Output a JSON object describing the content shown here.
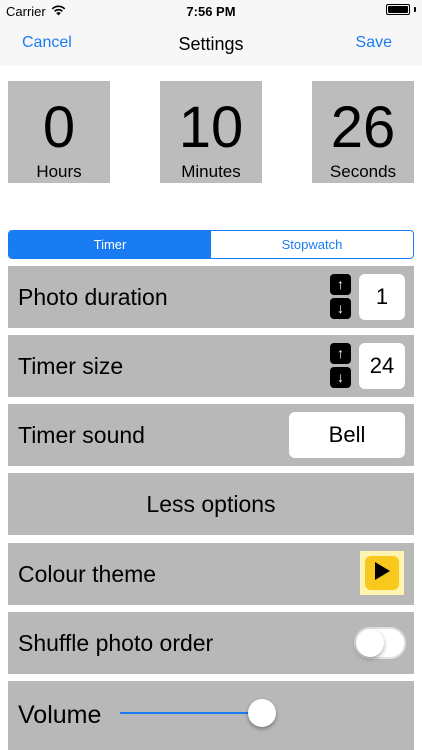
{
  "status_bar": {
    "carrier": "Carrier",
    "time": "7:56 PM"
  },
  "nav": {
    "cancel": "Cancel",
    "title": "Settings",
    "save": "Save"
  },
  "timer": {
    "hours": {
      "value": "0",
      "label": "Hours"
    },
    "minutes": {
      "value": "10",
      "label": "Minutes"
    },
    "seconds": {
      "value": "26",
      "label": "Seconds"
    }
  },
  "segmented": {
    "timer": "Timer",
    "stopwatch": "Stopwatch",
    "selected": "Timer"
  },
  "settings": {
    "photo_duration": {
      "label": "Photo duration",
      "value": "1"
    },
    "timer_size": {
      "label": "Timer size",
      "value": "24"
    },
    "timer_sound": {
      "label": "Timer sound",
      "value": "Bell"
    },
    "less_options": "Less options",
    "colour_theme": {
      "label": "Colour theme",
      "icon": "play-icon",
      "icon_color": "#f8c81c"
    },
    "shuffle": {
      "label": "Shuffle photo order",
      "on": false
    },
    "volume": {
      "label": "Volume",
      "level": 0.92
    }
  },
  "colors": {
    "accent": "#1a7cf2",
    "row_background": "#b8b8b8",
    "time_box_background": "#bcbcbc"
  },
  "icons": {
    "wifi": "wifi-icon",
    "battery": "battery-icon",
    "up": "arrow-up-icon",
    "down": "arrow-down-icon"
  }
}
